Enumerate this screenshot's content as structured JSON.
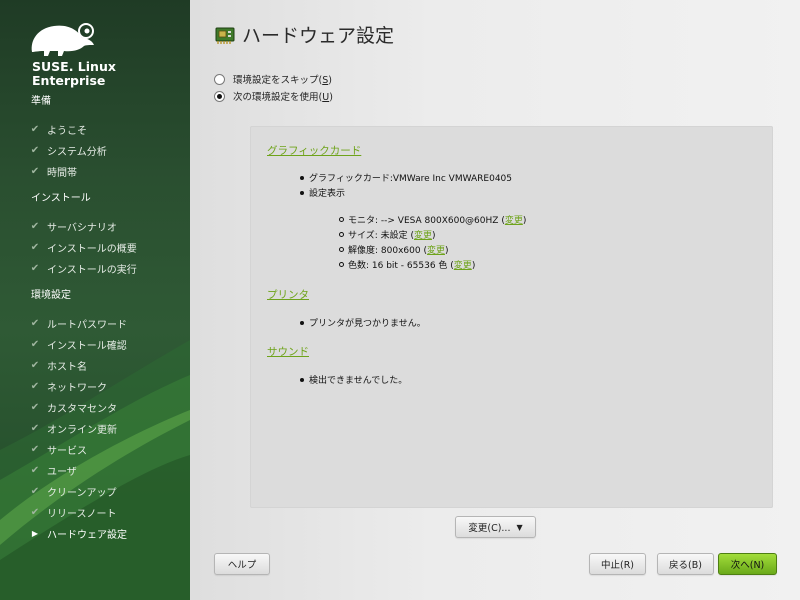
{
  "sidebar": {
    "brand_line1": "SUSE. Linux",
    "brand_line2": "Enterprise",
    "sections": [
      {
        "title": "準備",
        "items": [
          {
            "label": "ようこそ",
            "done": true
          },
          {
            "label": "システム分析",
            "done": true
          },
          {
            "label": "時間帯",
            "done": true
          }
        ]
      },
      {
        "title": "インストール",
        "items": [
          {
            "label": "サーバシナリオ",
            "done": true
          },
          {
            "label": "インストールの概要",
            "done": true
          },
          {
            "label": "インストールの実行",
            "done": true
          }
        ]
      },
      {
        "title": "環境設定",
        "items": [
          {
            "label": "ルートパスワード",
            "done": true
          },
          {
            "label": "インストール確認",
            "done": true
          },
          {
            "label": "ホスト名",
            "done": true
          },
          {
            "label": "ネットワーク",
            "done": true
          },
          {
            "label": "カスタマセンタ",
            "done": true
          },
          {
            "label": "オンライン更新",
            "done": true
          },
          {
            "label": "サービス",
            "done": true
          },
          {
            "label": "ユーザ",
            "done": true
          },
          {
            "label": "クリーンアップ",
            "done": true
          },
          {
            "label": "リリースノート",
            "done": true
          },
          {
            "label": "ハードウェア設定",
            "done": false,
            "current": true
          }
        ]
      }
    ]
  },
  "header": {
    "title": "ハードウェア設定",
    "icon": "hardware-card-icon"
  },
  "options": {
    "skip": {
      "label": "環境設定をスキップ",
      "mnemonic": "S",
      "selected": false
    },
    "use": {
      "label": "次の環境設定を使用",
      "mnemonic": "U",
      "selected": true
    }
  },
  "summary": {
    "graphics": {
      "heading": "グラフィックカード",
      "card_label": "グラフィックカード:VMWare Inc VMWARE0405",
      "display_label": "設定表示",
      "monitor": "モニタ: --> VESA 800X600@60HZ",
      "size": "サイズ: 未設定",
      "resolution": "解像度: 800x600",
      "colors": "色数: 16 bit - 65536 色",
      "change": "変更"
    },
    "printer": {
      "heading": "プリンタ",
      "text": "プリンタが見つかりません。"
    },
    "sound": {
      "heading": "サウンド",
      "text": "検出できませんでした。"
    }
  },
  "buttons": {
    "change": "変更(C)...",
    "help": "ヘルプ",
    "abort": "中止(R)",
    "back": "戻る(B)",
    "next": "次へ(N)"
  },
  "colors": {
    "accent_green": "#6ea31a",
    "sidebar_dark": "#1f3b25",
    "next_button": "#8cc42a"
  }
}
